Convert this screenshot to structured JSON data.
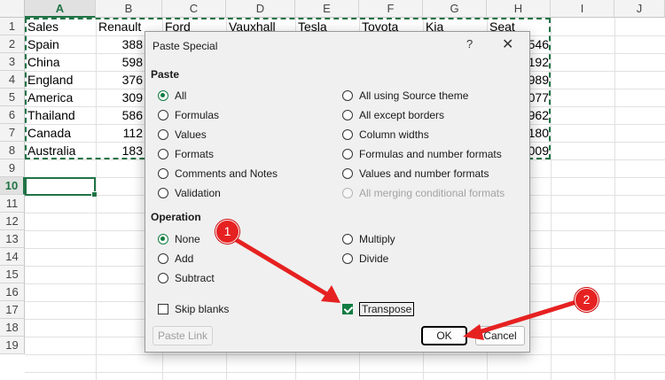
{
  "sheet": {
    "columns": [
      "A",
      "B",
      "C",
      "D",
      "E",
      "F",
      "G",
      "H",
      "I",
      "J"
    ],
    "selected_column": "A",
    "rows": [
      "1",
      "2",
      "3",
      "4",
      "5",
      "6",
      "7",
      "8",
      "9",
      "10",
      "11",
      "12",
      "13",
      "14",
      "15",
      "16",
      "17",
      "18",
      "19"
    ],
    "selected_row": "10",
    "header_row": [
      "Sales",
      "Renault",
      "Ford",
      "Vauxhall",
      "Tesla",
      "Toyota",
      "Kia",
      "Seat"
    ],
    "col_a": [
      "Spain",
      "China",
      "England",
      "America",
      "Thailand",
      "Canada",
      "Australia"
    ],
    "col_b": [
      "388",
      "598",
      "376",
      "309",
      "586",
      "112",
      "183"
    ],
    "col_h_tail": [
      "546",
      "192",
      "989",
      "077",
      "962",
      "180",
      "009"
    ],
    "accent_color": "#217346"
  },
  "dialog": {
    "title": "Paste Special",
    "help": "?",
    "close": "✕",
    "paste_section": "Paste",
    "paste_left": [
      "All",
      "Formulas",
      "Values",
      "Formats",
      "Comments and Notes",
      "Validation"
    ],
    "paste_right": [
      "All using Source theme",
      "All except borders",
      "Column widths",
      "Formulas and number formats",
      "Values and number formats",
      "All merging conditional formats"
    ],
    "operation_section": "Operation",
    "operation_left": [
      "None",
      "Add",
      "Subtract"
    ],
    "operation_right": [
      "Multiply",
      "Divide"
    ],
    "skip_blanks": "Skip blanks",
    "transpose": "Transpose",
    "transpose_checked": true,
    "paste_link": "Paste Link",
    "ok": "OK",
    "cancel": "Cancel"
  },
  "annotations": {
    "badge_1": "1",
    "badge_2": "2",
    "color": "#e62121"
  }
}
